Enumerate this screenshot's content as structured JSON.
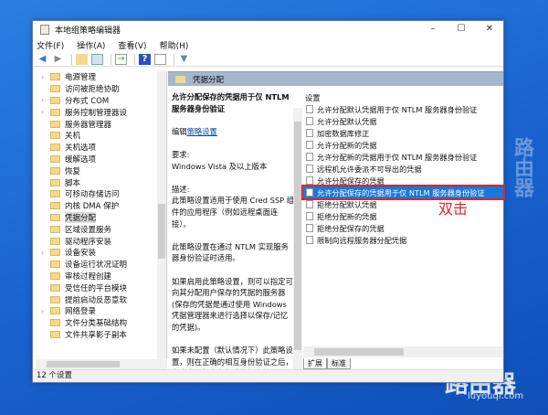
{
  "window": {
    "title": "本地组策略编辑器",
    "minimize": "–",
    "maximize": "☐",
    "close": "✕"
  },
  "menu": [
    "文件(F)",
    "操作(A)",
    "查看(V)",
    "帮助(H)"
  ],
  "tree": [
    {
      "label": "电源管理",
      "expand": true
    },
    {
      "label": "访问被拒绝协助",
      "expand": false
    },
    {
      "label": "分布式 COM",
      "expand": true
    },
    {
      "label": "服务控制管理器设",
      "expand": true
    },
    {
      "label": "服务器管理器",
      "expand": false
    },
    {
      "label": "关机",
      "expand": false
    },
    {
      "label": "关机选项",
      "expand": false
    },
    {
      "label": "缓解选项",
      "expand": false
    },
    {
      "label": "恢复",
      "expand": false
    },
    {
      "label": "脚本",
      "expand": false
    },
    {
      "label": "可移动存储访问",
      "expand": false
    },
    {
      "label": "内核 DMA 保护",
      "expand": false
    },
    {
      "label": "凭据分配",
      "expand": false,
      "selected": true
    },
    {
      "label": "区域设置服务",
      "expand": false
    },
    {
      "label": "驱动程序安装",
      "expand": false
    },
    {
      "label": "设备安装",
      "expand": true
    },
    {
      "label": "设备运行状况证明",
      "expand": false
    },
    {
      "label": "审核过程创建",
      "expand": false
    },
    {
      "label": "受信任的平台模块",
      "expand": false
    },
    {
      "label": "提前启动反恶意软",
      "expand": false
    },
    {
      "label": "网络登录",
      "expand": true
    },
    {
      "label": "文件分类基础结构",
      "expand": false
    },
    {
      "label": "文件共享影子副本",
      "expand": false
    }
  ],
  "header": "凭据分配",
  "desc": {
    "title": "允许分配保存的凭据用于仅 NTLM 服务器身份验证",
    "edit_prefix": "编辑",
    "edit_link": "策略设置",
    "req_label": "要求:",
    "req": "Windows Vista 及以上版本",
    "desc_label": "描述:",
    "p1": "此策略设置适用于使用 Cred SSP 组件的应用程序（例如远程桌面连接）。",
    "p2": "此策略设置在通过 NTLM 实现服务器身份验证时适用。",
    "p3": "如果启用此策略设置，则可以指定可向其分配用户保存的凭据的服务器(保存的凭据是通过使用 Windows 凭据管理器来进行选择以保存/记忆的凭据)。",
    "p4": "如果未配置（默认情况下）此策略设置，则在正确的相互身份验证之后，允许向运行在任何计算机上的"
  },
  "list": {
    "header": "设置",
    "items": [
      "允许分配默认凭据用于仅 NTLM 服务器身份验证",
      "允许分配默认凭据",
      "加密数据库修正",
      "允许分配新的凭据",
      "允许分配新的凭据用于仅 NTLM 服务器身份验证",
      "远程机允许委派不可导出的凭据",
      "允许分配保存的凭据",
      "允许分配保存的凭据用于仅 NTLM 服务器身份验证",
      "拒绝分配默认凭据",
      "拒绝分配新的凭据",
      "拒绝分配保存的凭据",
      "限制向远程服务器分配凭据"
    ],
    "selected": 7
  },
  "tabs": [
    "扩展",
    "标准"
  ],
  "status": "12 个设置",
  "annotation": "双击",
  "watermark": {
    "brand": "路由器",
    "url": "luyouqi.com"
  }
}
